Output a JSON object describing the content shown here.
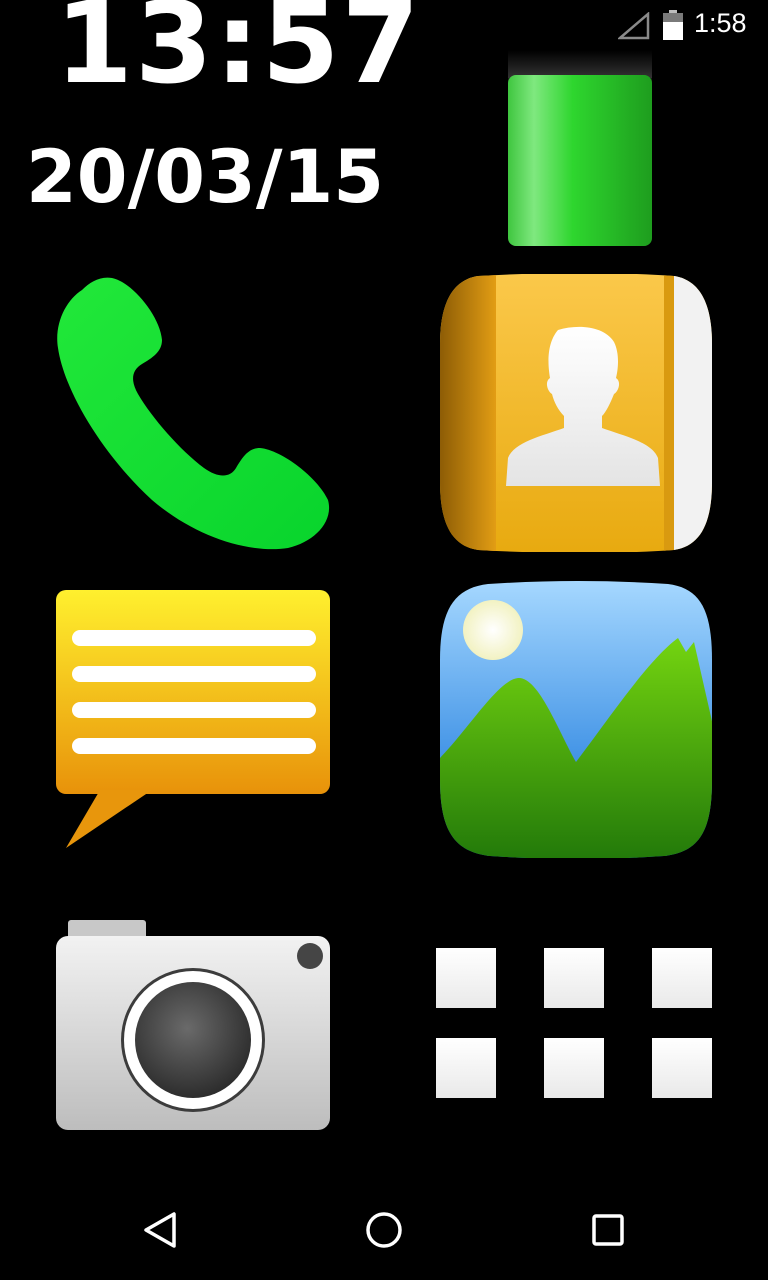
{
  "status_bar": {
    "time": "1:58",
    "signal_icon": "signal-empty-icon",
    "battery_icon": "battery-icon"
  },
  "clock": {
    "time": "13:57",
    "date": "20/03/15"
  },
  "battery_widget": {
    "icon": "battery-level-icon",
    "level_fraction": 0.87,
    "color": "#22dd22"
  },
  "tiles": [
    {
      "name": "phone",
      "icon": "phone-icon",
      "color": "#11ee33"
    },
    {
      "name": "contacts",
      "icon": "contacts-book-icon",
      "color": "#f5b51e"
    },
    {
      "name": "messages",
      "icon": "message-bubble-icon",
      "color": "#fce233"
    },
    {
      "name": "gallery",
      "icon": "gallery-landscape-icon",
      "color": "#4aa0e8"
    },
    {
      "name": "camera",
      "icon": "camera-icon",
      "color": "#e5e5e5"
    },
    {
      "name": "apps",
      "icon": "app-grid-icon",
      "color": "#ffffff"
    }
  ],
  "nav_bar": {
    "back_icon": "back-triangle-icon",
    "home_icon": "home-circle-icon",
    "recents_icon": "recents-square-icon"
  }
}
